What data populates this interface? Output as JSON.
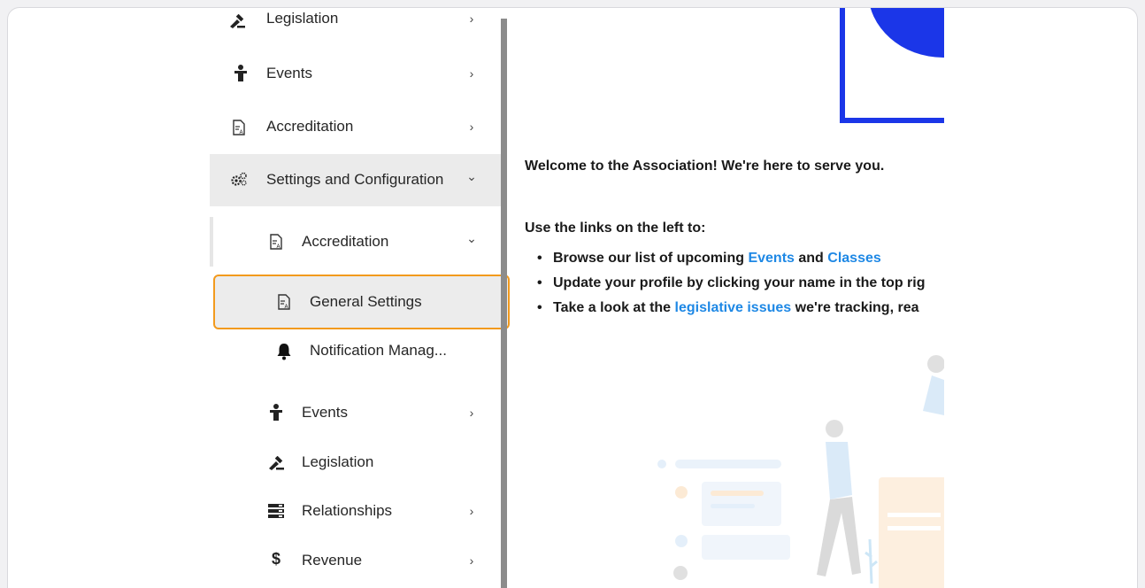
{
  "sidebar": {
    "items": [
      {
        "label": "Legislation",
        "icon": "gavel-icon",
        "chevron": "›"
      },
      {
        "label": "Events",
        "icon": "person-podium-icon",
        "chevron": "›"
      },
      {
        "label": "Accreditation",
        "icon": "document-icon",
        "chevron": "›"
      },
      {
        "label": "Settings and Configuration",
        "icon": "gears-icon",
        "chevron": "⌄"
      }
    ],
    "sub_items": [
      {
        "label": "Accreditation",
        "icon": "document-icon",
        "chevron": "⌄"
      },
      {
        "label": "General Settings",
        "icon": "document-icon"
      },
      {
        "label": "Notification Manag...",
        "icon": "bell-icon"
      },
      {
        "label": "Events",
        "icon": "person-podium-icon",
        "chevron": "›"
      },
      {
        "label": "Legislation",
        "icon": "gavel-icon"
      },
      {
        "label": "Relationships",
        "icon": "list-icon",
        "chevron": "›"
      },
      {
        "label": "Revenue",
        "icon": "dollar-icon",
        "chevron": "›"
      }
    ]
  },
  "content": {
    "welcome": "Welcome to the Association!  We're here to serve you.",
    "use_links": "Use the links on the left to:",
    "bullet1": {
      "pre": "Browse our list of upcoming ",
      "link1": "Events",
      "mid": " and ",
      "link2": "Classes"
    },
    "bullet2": {
      "text": "Update your profile by clicking your name in the top rig"
    },
    "bullet3": {
      "pre": "Take a look at the ",
      "link": "legislative issues",
      "post": " we're tracking, rea"
    }
  },
  "colors": {
    "accent_link": "#1e88e5",
    "highlight_border": "#f29a1d",
    "logo_blue": "#1b36e8"
  }
}
